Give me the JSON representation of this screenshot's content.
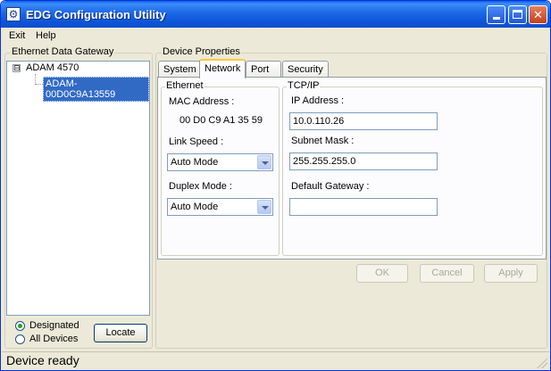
{
  "window": {
    "title": "EDG Configuration Utility",
    "icon": "edg-app-icon",
    "title_color": "#ffffff",
    "titlebar_color": "#0c54d8"
  },
  "menu": {
    "items": [
      {
        "label": "Exit"
      },
      {
        "label": "Help"
      }
    ]
  },
  "gateway": {
    "group_label": "Ethernet Data Gateway",
    "tree": {
      "expander": "⊟",
      "root": "ADAM 4570",
      "children": [
        {
          "label": "ADAM-00D0C9A13559",
          "selected": true
        }
      ]
    },
    "radios": [
      {
        "label": "Designated",
        "checked": true
      },
      {
        "label": "All Devices",
        "checked": false
      }
    ],
    "locate_button": "Locate"
  },
  "properties": {
    "group_label": "Device Properties",
    "tabs": [
      {
        "label": "System",
        "active": false
      },
      {
        "label": "Network",
        "active": true
      },
      {
        "label": "Port",
        "active": false
      },
      {
        "label": "Security",
        "active": false
      }
    ],
    "ethernet": {
      "group_label": "Ethernet",
      "mac_label": "MAC Address :",
      "mac_value": "00 D0 C9 A1 35 59",
      "link_speed_label": "Link Speed :",
      "link_speed_value": "Auto Mode",
      "duplex_label": "Duplex Mode :",
      "duplex_value": "Auto Mode"
    },
    "tcpip": {
      "group_label": "TCP/IP",
      "ip_label": "IP Address :",
      "ip_value": "10.0.110.26",
      "subnet_label": "Subnet Mask :",
      "subnet_value": "255.255.255.0",
      "gateway_label": "Default Gateway :",
      "gateway_value": ""
    },
    "buttons": {
      "ok": "OK",
      "cancel": "Cancel",
      "apply": "Apply"
    }
  },
  "status": {
    "text": "Device ready"
  },
  "colors": {
    "selection": "#316ac5",
    "face": "#ece9d8",
    "active_tab_accent": "#ffc83c",
    "radio_dot": "#21a121"
  }
}
